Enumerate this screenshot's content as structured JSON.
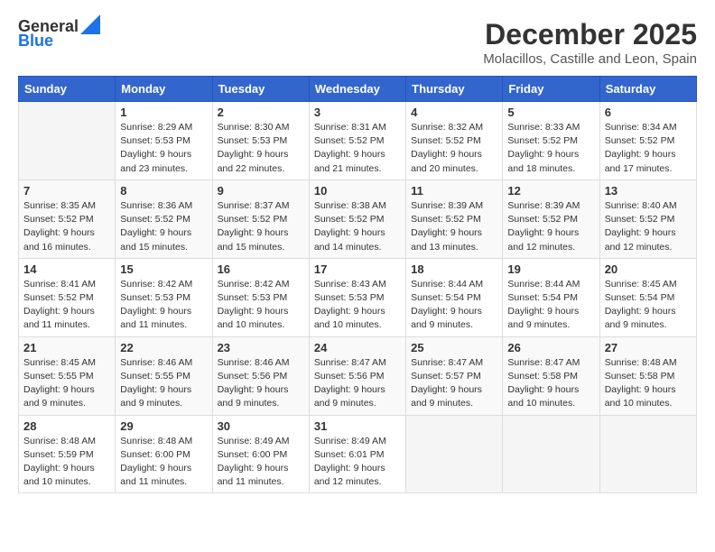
{
  "header": {
    "logo_line1": "General",
    "logo_line2": "Blue",
    "month": "December 2025",
    "location": "Molacillos, Castille and Leon, Spain"
  },
  "weekdays": [
    "Sunday",
    "Monday",
    "Tuesday",
    "Wednesday",
    "Thursday",
    "Friday",
    "Saturday"
  ],
  "weeks": [
    [
      {
        "day": "",
        "info": ""
      },
      {
        "day": "1",
        "info": "Sunrise: 8:29 AM\nSunset: 5:53 PM\nDaylight: 9 hours\nand 23 minutes."
      },
      {
        "day": "2",
        "info": "Sunrise: 8:30 AM\nSunset: 5:53 PM\nDaylight: 9 hours\nand 22 minutes."
      },
      {
        "day": "3",
        "info": "Sunrise: 8:31 AM\nSunset: 5:52 PM\nDaylight: 9 hours\nand 21 minutes."
      },
      {
        "day": "4",
        "info": "Sunrise: 8:32 AM\nSunset: 5:52 PM\nDaylight: 9 hours\nand 20 minutes."
      },
      {
        "day": "5",
        "info": "Sunrise: 8:33 AM\nSunset: 5:52 PM\nDaylight: 9 hours\nand 18 minutes."
      },
      {
        "day": "6",
        "info": "Sunrise: 8:34 AM\nSunset: 5:52 PM\nDaylight: 9 hours\nand 17 minutes."
      }
    ],
    [
      {
        "day": "7",
        "info": "Sunrise: 8:35 AM\nSunset: 5:52 PM\nDaylight: 9 hours\nand 16 minutes."
      },
      {
        "day": "8",
        "info": "Sunrise: 8:36 AM\nSunset: 5:52 PM\nDaylight: 9 hours\nand 15 minutes."
      },
      {
        "day": "9",
        "info": "Sunrise: 8:37 AM\nSunset: 5:52 PM\nDaylight: 9 hours\nand 15 minutes."
      },
      {
        "day": "10",
        "info": "Sunrise: 8:38 AM\nSunset: 5:52 PM\nDaylight: 9 hours\nand 14 minutes."
      },
      {
        "day": "11",
        "info": "Sunrise: 8:39 AM\nSunset: 5:52 PM\nDaylight: 9 hours\nand 13 minutes."
      },
      {
        "day": "12",
        "info": "Sunrise: 8:39 AM\nSunset: 5:52 PM\nDaylight: 9 hours\nand 12 minutes."
      },
      {
        "day": "13",
        "info": "Sunrise: 8:40 AM\nSunset: 5:52 PM\nDaylight: 9 hours\nand 12 minutes."
      }
    ],
    [
      {
        "day": "14",
        "info": "Sunrise: 8:41 AM\nSunset: 5:52 PM\nDaylight: 9 hours\nand 11 minutes."
      },
      {
        "day": "15",
        "info": "Sunrise: 8:42 AM\nSunset: 5:53 PM\nDaylight: 9 hours\nand 11 minutes."
      },
      {
        "day": "16",
        "info": "Sunrise: 8:42 AM\nSunset: 5:53 PM\nDaylight: 9 hours\nand 10 minutes."
      },
      {
        "day": "17",
        "info": "Sunrise: 8:43 AM\nSunset: 5:53 PM\nDaylight: 9 hours\nand 10 minutes."
      },
      {
        "day": "18",
        "info": "Sunrise: 8:44 AM\nSunset: 5:54 PM\nDaylight: 9 hours\nand 9 minutes."
      },
      {
        "day": "19",
        "info": "Sunrise: 8:44 AM\nSunset: 5:54 PM\nDaylight: 9 hours\nand 9 minutes."
      },
      {
        "day": "20",
        "info": "Sunrise: 8:45 AM\nSunset: 5:54 PM\nDaylight: 9 hours\nand 9 minutes."
      }
    ],
    [
      {
        "day": "21",
        "info": "Sunrise: 8:45 AM\nSunset: 5:55 PM\nDaylight: 9 hours\nand 9 minutes."
      },
      {
        "day": "22",
        "info": "Sunrise: 8:46 AM\nSunset: 5:55 PM\nDaylight: 9 hours\nand 9 minutes."
      },
      {
        "day": "23",
        "info": "Sunrise: 8:46 AM\nSunset: 5:56 PM\nDaylight: 9 hours\nand 9 minutes."
      },
      {
        "day": "24",
        "info": "Sunrise: 8:47 AM\nSunset: 5:56 PM\nDaylight: 9 hours\nand 9 minutes."
      },
      {
        "day": "25",
        "info": "Sunrise: 8:47 AM\nSunset: 5:57 PM\nDaylight: 9 hours\nand 9 minutes."
      },
      {
        "day": "26",
        "info": "Sunrise: 8:47 AM\nSunset: 5:58 PM\nDaylight: 9 hours\nand 10 minutes."
      },
      {
        "day": "27",
        "info": "Sunrise: 8:48 AM\nSunset: 5:58 PM\nDaylight: 9 hours\nand 10 minutes."
      }
    ],
    [
      {
        "day": "28",
        "info": "Sunrise: 8:48 AM\nSunset: 5:59 PM\nDaylight: 9 hours\nand 10 minutes."
      },
      {
        "day": "29",
        "info": "Sunrise: 8:48 AM\nSunset: 6:00 PM\nDaylight: 9 hours\nand 11 minutes."
      },
      {
        "day": "30",
        "info": "Sunrise: 8:49 AM\nSunset: 6:00 PM\nDaylight: 9 hours\nand 11 minutes."
      },
      {
        "day": "31",
        "info": "Sunrise: 8:49 AM\nSunset: 6:01 PM\nDaylight: 9 hours\nand 12 minutes."
      },
      {
        "day": "",
        "info": ""
      },
      {
        "day": "",
        "info": ""
      },
      {
        "day": "",
        "info": ""
      }
    ]
  ]
}
